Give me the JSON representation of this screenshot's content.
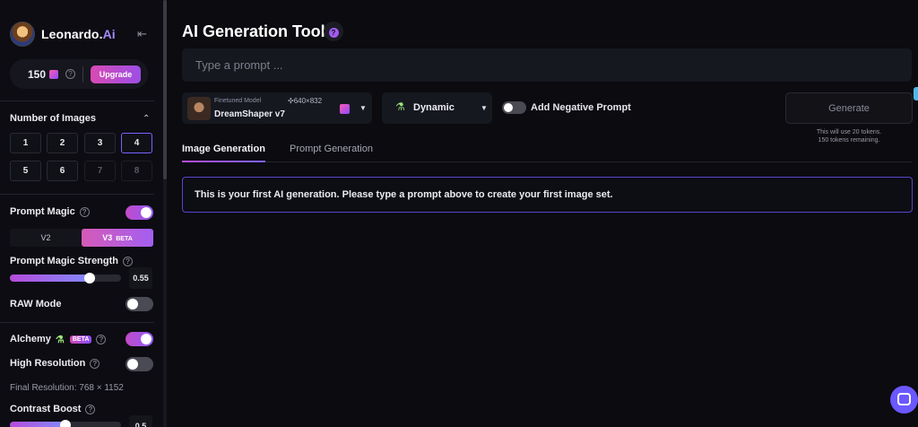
{
  "brand": {
    "name": "Leonardo.",
    "name_suffix": "Ai"
  },
  "tokens": {
    "count": "150",
    "upgrade_label": "Upgrade"
  },
  "number_of_images": {
    "title": "Number of Images",
    "options": [
      "1",
      "2",
      "3",
      "4",
      "5",
      "6",
      "7",
      "8"
    ],
    "selected": "4",
    "disabled": [
      "7",
      "8"
    ]
  },
  "prompt_magic": {
    "label": "Prompt Magic",
    "enabled": true,
    "versions": [
      "V2",
      "V3"
    ],
    "active_version": "V3",
    "beta_tag": "BETA"
  },
  "prompt_magic_strength": {
    "label": "Prompt Magic Strength",
    "value": "0.55",
    "fraction": 0.55
  },
  "raw_mode": {
    "label": "RAW Mode",
    "enabled": false
  },
  "alchemy": {
    "label": "Alchemy",
    "beta": "BETA",
    "enabled": true
  },
  "high_resolution": {
    "label": "High Resolution",
    "enabled": false
  },
  "final_resolution": "Final Resolution: 768 × 1152",
  "contrast_boost": {
    "label": "Contrast Boost",
    "value": "0.5",
    "fraction": 0.5
  },
  "header": {
    "title": "AI Generation Tool"
  },
  "prompt": {
    "placeholder": "Type a prompt ...",
    "value": ""
  },
  "model": {
    "sub_label": "Finetuned Model",
    "dimensions": "640×832",
    "name": "DreamShaper v7"
  },
  "style": {
    "label": "Dynamic"
  },
  "negative_prompt": {
    "label": "Add Negative Prompt",
    "enabled": false
  },
  "generate": {
    "label": "Generate",
    "note_line1": "This will use 20 tokens.",
    "note_line2": "150 tokens remaining."
  },
  "tabs": [
    {
      "label": "Image Generation",
      "active": true
    },
    {
      "label": "Prompt Generation",
      "active": false
    }
  ],
  "notice": "This is your first AI generation. Please type a prompt above to create your first image set.",
  "colors": {
    "accent_purple": "#8c4cff",
    "accent_pink": "#d84ab4",
    "background": "#0b0b10"
  },
  "icons": [
    "collapse-icon",
    "token-icon",
    "help-icon",
    "chevron-up-icon",
    "flask-icon",
    "move-icon",
    "caret-down-icon",
    "chat-icon"
  ]
}
